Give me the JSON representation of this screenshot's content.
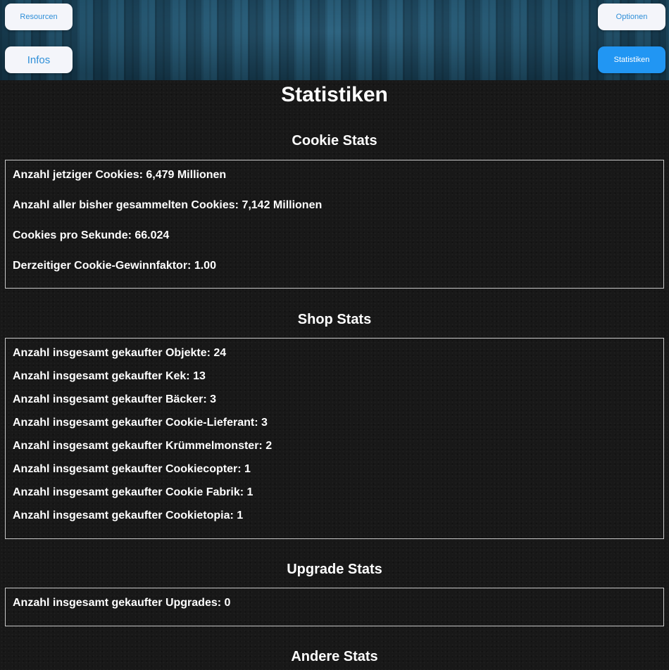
{
  "header": {
    "resourcen_label": "Resourcen",
    "infos_label": "Infos",
    "optionen_label": "Optionen",
    "statistiken_label": "Statistiken",
    "active_color": "#2196f3",
    "accent_color": "#2f8fd8"
  },
  "page": {
    "title": "Statistiken"
  },
  "cookie_stats": {
    "title": "Cookie Stats",
    "rows": [
      "Anzahl jetziger Cookies: 6,479 Millionen",
      "Anzahl aller bisher gesammelten Cookies: 7,142 Millionen",
      "Cookies pro Sekunde: 66.024",
      "Derzeitiger Cookie-Gewinnfaktor: 1.00"
    ]
  },
  "shop_stats": {
    "title": "Shop Stats",
    "rows": [
      "Anzahl insgesamt gekaufter Objekte: 24",
      "Anzahl insgesamt gekaufter Kek: 13",
      "Anzahl insgesamt gekaufter Bäcker: 3",
      "Anzahl insgesamt gekaufter Cookie-Lieferant: 3",
      "Anzahl insgesamt gekaufter Krümmelmonster: 2",
      "Anzahl insgesamt gekaufter Cookiecopter: 1",
      "Anzahl insgesamt gekaufter Cookie Fabrik: 1",
      "Anzahl insgesamt gekaufter Cookietopia: 1"
    ]
  },
  "upgrade_stats": {
    "title": "Upgrade Stats",
    "rows": [
      "Anzahl insgesamt gekaufter Upgrades: 0"
    ]
  },
  "other_stats": {
    "title": "Andere Stats"
  }
}
